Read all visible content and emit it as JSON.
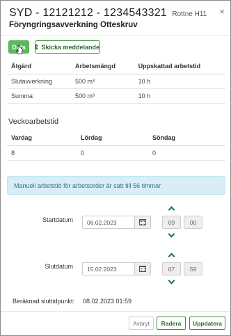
{
  "header": {
    "title": "SYD - 12121212 - 1234543321",
    "title_suffix": "Rottne H11",
    "subtitle": "Föryngringsavverkning Otteskruv",
    "close_icon": "close-icon"
  },
  "toolbar": {
    "data_label": "Data",
    "message_label": "Skicka meddelande",
    "message_icon": "envelope-icon"
  },
  "work_table": {
    "columns": [
      "Åtgärd",
      "Arbetsmängd",
      "Uppskattad arbetstid"
    ],
    "rows": [
      [
        "Slutavverkning",
        "500 m³",
        "10 h"
      ],
      [
        "Summa",
        "500 m³",
        "10 h"
      ]
    ]
  },
  "weekly": {
    "title": "Veckoarbetstid",
    "columns": [
      "Vardag",
      "Lördag",
      "Söndag"
    ],
    "values": [
      "8",
      "0",
      "0"
    ]
  },
  "alert": {
    "text": "Manuell arbetstid för arbetsorder är satt till 56 timmar"
  },
  "start": {
    "label": "Startdatum",
    "date": "06.02.2023",
    "hour": "09",
    "minute": "00"
  },
  "end": {
    "label": "Slutdatum",
    "date": "15.02.2023",
    "hour": "07",
    "minute": "59"
  },
  "calculated": {
    "label": "Beräknad sluttidpunkt:",
    "value": "08.02.2023 01:59"
  },
  "footer": {
    "cancel_label": "Avbryt",
    "delete_label": "Radera",
    "update_label": "Uppdatera"
  },
  "colors": {
    "primary_green": "#5cb85c",
    "dark_green": "#1e6b47",
    "alert_bg": "#d9edf7",
    "alert_text": "#31708f"
  }
}
